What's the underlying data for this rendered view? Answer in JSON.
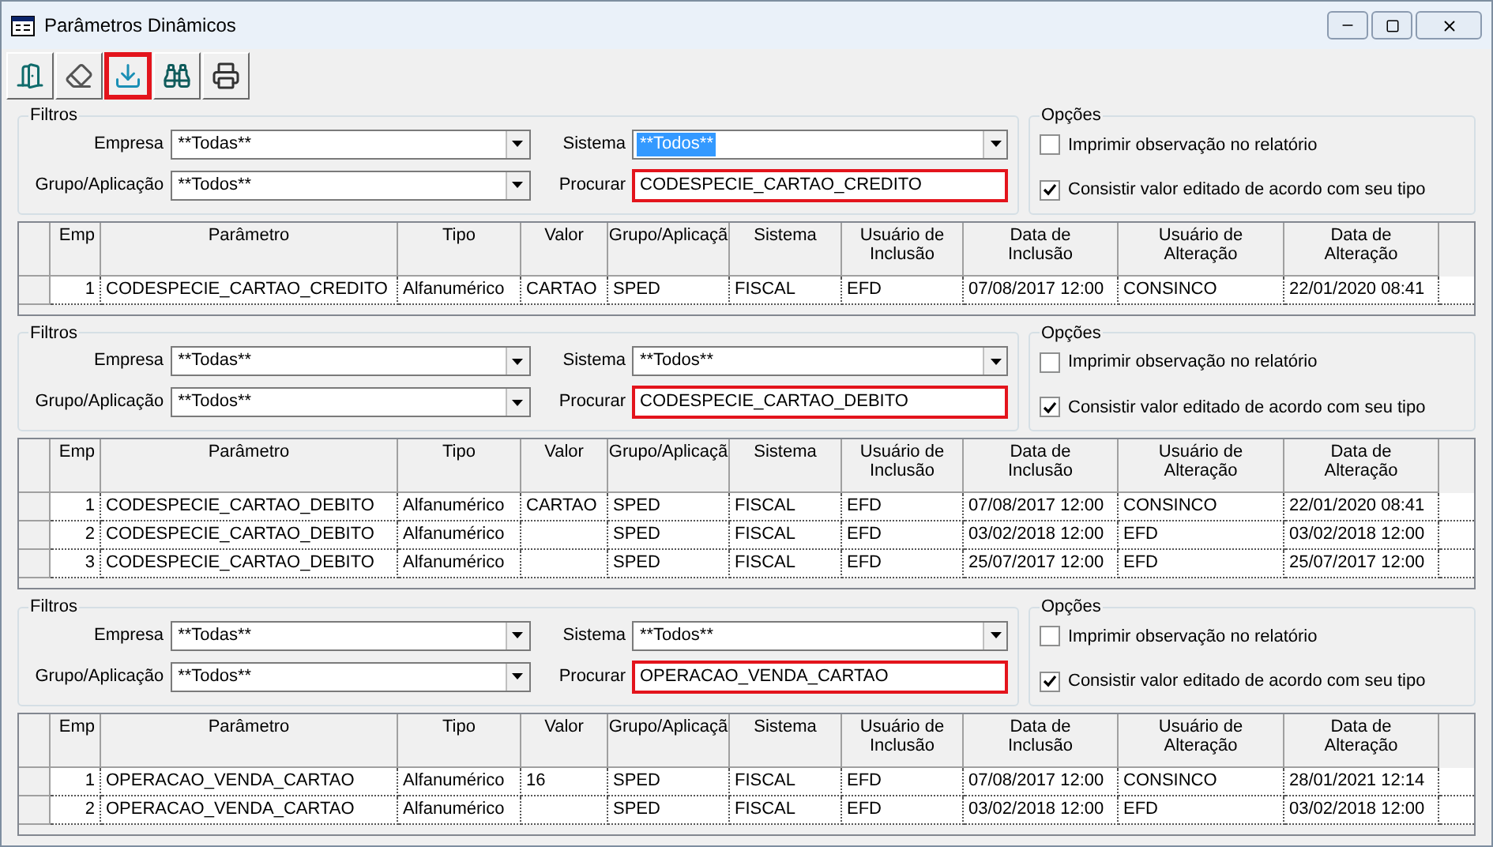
{
  "window": {
    "title": "Parâmetros Dinâmicos"
  },
  "toolbar": [
    {
      "kind": "exit",
      "highlighted": false
    },
    {
      "kind": "erase",
      "highlighted": false
    },
    {
      "kind": "import",
      "highlighted": true
    },
    {
      "kind": "find",
      "highlighted": false
    },
    {
      "kind": "print",
      "highlighted": false
    }
  ],
  "sections": [
    {
      "filters": {
        "legend": "Filtros",
        "empresa_label": "Empresa",
        "empresa": "**Todas**",
        "grupo_label": "Grupo/Aplicação",
        "grupo": "**Todos**",
        "sistema_label": "Sistema",
        "sistema": "**Todos**",
        "sistema_focused": true,
        "procurar_label": "Procurar",
        "procurar": "CODESPECIE_CARTAO_CREDITO",
        "procurar_highlighted": true
      },
      "options": {
        "legend": "Opções",
        "items": [
          {
            "label": "Imprimir observação no relatório",
            "checked": false
          },
          {
            "label": "Consistir valor editado de acordo com seu tipo",
            "checked": true
          }
        ]
      },
      "table": {
        "columns": [
          "Emp",
          "Parâmetro",
          "Tipo",
          "Valor",
          "Grupo/Aplicaçã",
          "Sistema",
          "Usuário de Inclusão",
          "Data de Inclusão",
          "Usuário de Alteração",
          "Data de Alteração"
        ],
        "rows": [
          [
            "1",
            "CODESPECIE_CARTAO_CREDITO",
            "Alfanumérico",
            "CARTAO",
            "SPED",
            "FISCAL",
            "EFD",
            "07/08/2017 12:00",
            "CONSINCO",
            "22/01/2020 08:41"
          ]
        ]
      }
    },
    {
      "filters": {
        "legend": "Filtros",
        "empresa_label": "Empresa",
        "empresa": "**Todas**",
        "grupo_label": "Grupo/Aplicação",
        "grupo": "**Todos**",
        "sistema_label": "Sistema",
        "sistema": "**Todos**",
        "sistema_focused": false,
        "procurar_label": "Procurar",
        "procurar": "CODESPECIE_CARTAO_DEBITO",
        "procurar_highlighted": true
      },
      "options": {
        "legend": "Opções",
        "items": [
          {
            "label": "Imprimir observação no relatório",
            "checked": false
          },
          {
            "label": "Consistir valor editado de acordo com seu tipo",
            "checked": true
          }
        ]
      },
      "table": {
        "columns": [
          "Emp",
          "Parâmetro",
          "Tipo",
          "Valor",
          "Grupo/Aplicaçã",
          "Sistema",
          "Usuário de Inclusão",
          "Data de Inclusão",
          "Usuário de Alteração",
          "Data de Alteração"
        ],
        "rows": [
          [
            "1",
            "CODESPECIE_CARTAO_DEBITO",
            "Alfanumérico",
            "CARTAO",
            "SPED",
            "FISCAL",
            "EFD",
            "07/08/2017 12:00",
            "CONSINCO",
            "22/01/2020 08:41"
          ],
          [
            "2",
            "CODESPECIE_CARTAO_DEBITO",
            "Alfanumérico",
            "",
            "SPED",
            "FISCAL",
            "EFD",
            "03/02/2018 12:00",
            "EFD",
            "03/02/2018 12:00"
          ],
          [
            "3",
            "CODESPECIE_CARTAO_DEBITO",
            "Alfanumérico",
            "",
            "SPED",
            "FISCAL",
            "EFD",
            "25/07/2017 12:00",
            "EFD",
            "25/07/2017 12:00"
          ]
        ]
      }
    },
    {
      "filters": {
        "legend": "Filtros",
        "empresa_label": "Empresa",
        "empresa": "**Todas**",
        "grupo_label": "Grupo/Aplicação",
        "grupo": "**Todos**",
        "sistema_label": "Sistema",
        "sistema": "**Todos**",
        "sistema_focused": false,
        "procurar_label": "Procurar",
        "procurar": "OPERACAO_VENDA_CARTAO",
        "procurar_highlighted": true
      },
      "options": {
        "legend": "Opções",
        "items": [
          {
            "label": "Imprimir observação no relatório",
            "checked": false
          },
          {
            "label": "Consistir valor editado de acordo com seu tipo",
            "checked": true
          }
        ]
      },
      "table": {
        "columns": [
          "Emp",
          "Parâmetro",
          "Tipo",
          "Valor",
          "Grupo/Aplicaçã",
          "Sistema",
          "Usuário de Inclusão",
          "Data de Inclusão",
          "Usuário de Alteração",
          "Data de Alteração"
        ],
        "rows": [
          [
            "1",
            "OPERACAO_VENDA_CARTAO",
            "Alfanumérico",
            "16",
            "SPED",
            "FISCAL",
            "EFD",
            "07/08/2017 12:00",
            "CONSINCO",
            "28/01/2021 12:14"
          ],
          [
            "2",
            "OPERACAO_VENDA_CARTAO",
            "Alfanumérico",
            "",
            "SPED",
            "FISCAL",
            "EFD",
            "03/02/2018 12:00",
            "EFD",
            "03/02/2018 12:00"
          ]
        ]
      }
    }
  ]
}
